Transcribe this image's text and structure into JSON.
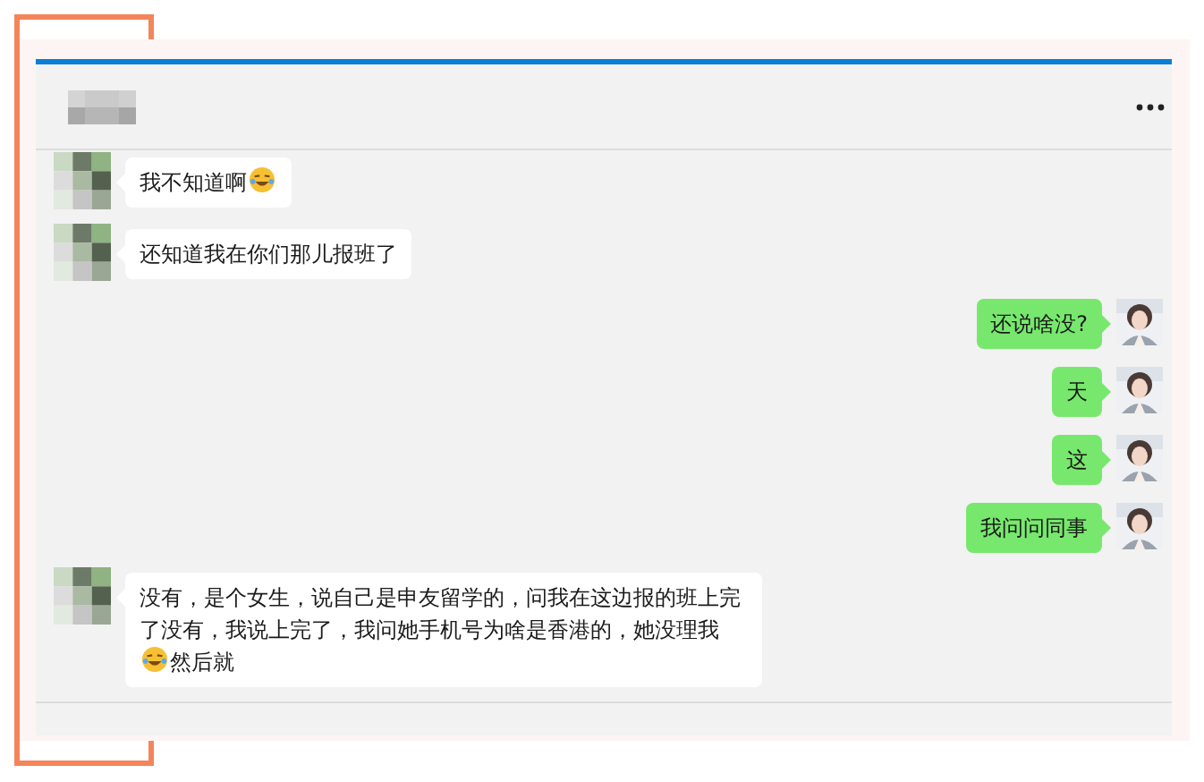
{
  "messages": [
    {
      "kind": "incoming",
      "segments": [
        {
          "kind": "text",
          "text": "我不知道啊"
        },
        {
          "kind": "emoji"
        }
      ]
    },
    {
      "kind": "incoming",
      "segments": [
        {
          "kind": "text",
          "text": "还知道我在你们那儿报班了"
        }
      ]
    },
    {
      "kind": "outgoing",
      "segments": [
        {
          "kind": "text",
          "text": "还说啥没?"
        }
      ]
    },
    {
      "kind": "outgoing",
      "segments": [
        {
          "kind": "text",
          "text": "天"
        }
      ]
    },
    {
      "kind": "outgoing",
      "segments": [
        {
          "kind": "text",
          "text": "这"
        }
      ]
    },
    {
      "kind": "outgoing",
      "segments": [
        {
          "kind": "text",
          "text": "我问问同事"
        }
      ]
    },
    {
      "kind": "incoming",
      "segments": [
        {
          "kind": "text",
          "text": "没有，是个女生，说自己是申友留学的，问我在这边报的班上完了没有，我说上完了，我问她手机号为啥是香港的，她没理我"
        },
        {
          "kind": "emoji"
        },
        {
          "kind": "text",
          "text": "然后就"
        }
      ]
    }
  ]
}
